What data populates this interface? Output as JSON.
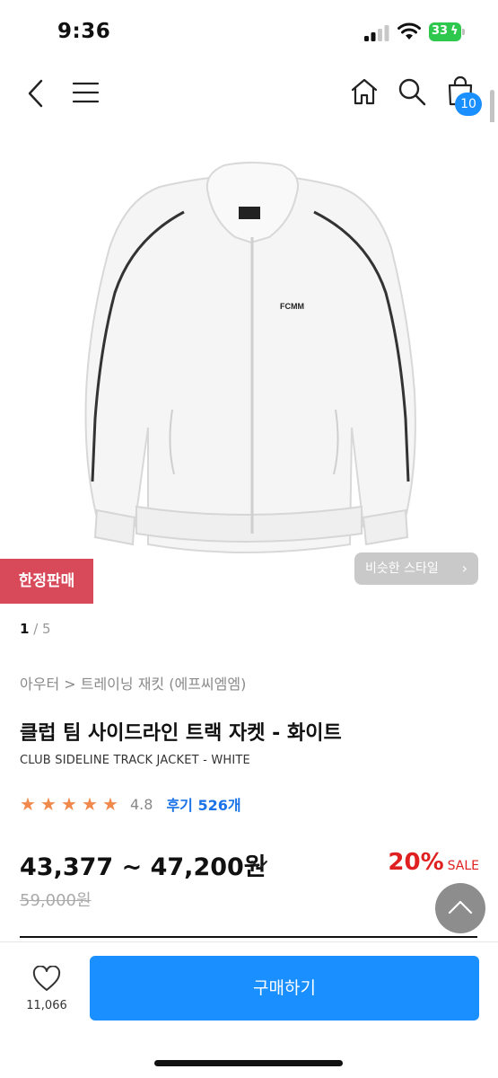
{
  "status": {
    "time": "9:36",
    "battery": "33"
  },
  "nav": {
    "cart_count": "10"
  },
  "badges": {
    "limited": "한정판매",
    "similar": "비슷한 스타일"
  },
  "image": {
    "logo_text": "FCMM"
  },
  "pager": {
    "current": "1",
    "total": "/ 5"
  },
  "product": {
    "breadcrumb": "아우터 > 트레이닝 재킷 (에프씨엠엠)",
    "title_ko": "클럽 팀 사이드라인 트랙 자켓 - 화이트",
    "title_en": "CLUB SIDELINE TRACK JACKET - WHITE",
    "rating": "4.8",
    "rating_value": 4.8,
    "review_link": "후기 526개",
    "price_range": "43,377 ~ 47,200원",
    "discount_percent": "20%",
    "sale_label": "SALE",
    "original_price": "59,000원"
  },
  "bottom": {
    "like_count": "11,066",
    "buy_label": "구매하기"
  },
  "colors": {
    "accent": "#1a8fff",
    "limited": "#d84a5a",
    "discount": "#e02020",
    "star": "#f0894b",
    "review": "#1a73e8"
  },
  "icons": {
    "back": "chevron-left-icon",
    "menu": "hamburger-icon",
    "home": "home-icon",
    "search": "search-icon",
    "cart": "shopping-bag-icon",
    "like": "heart-icon",
    "scroll_top": "chevron-up-icon"
  }
}
